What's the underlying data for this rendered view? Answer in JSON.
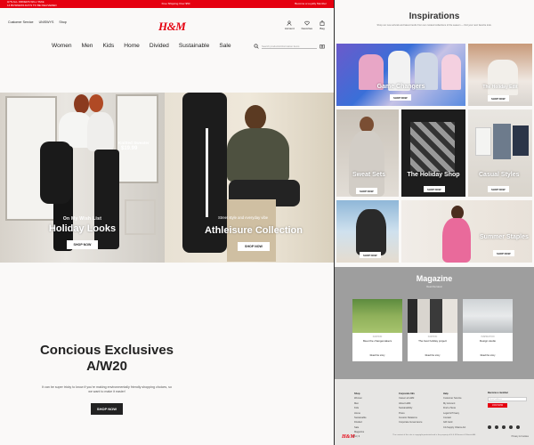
{
  "colors": {
    "brand_red": "#e50010",
    "magazine_bg": "#9e9e9e",
    "footer_bg": "#e7e6e4"
  },
  "topbar": {
    "left_lines": [
      "H7N ALL ORDERS WILL TAKE",
      "14 BUSINESS DAYS TO BE DELIVERED"
    ],
    "center": "Free Shipping Over $50",
    "right": "Become a Loyalty Member"
  },
  "header": {
    "links": [
      "Customer Service",
      "UNISWYS",
      "Shop"
    ],
    "logo": "H&M",
    "icons": [
      {
        "name": "account-icon",
        "label": "Account"
      },
      {
        "name": "favorites-icon",
        "label": "Favorites"
      },
      {
        "name": "bag-icon",
        "label": "Bag"
      }
    ],
    "nav": [
      "Women",
      "Men",
      "Kids",
      "Home",
      "Divided",
      "Sustainable",
      "Sale"
    ],
    "search_placeholder": "Search products/information items"
  },
  "hero": {
    "left": {
      "subtitle": "On My Wish List",
      "title": "Holiday Looks",
      "button": "SHOP NOW",
      "tag_name": "Knitted Sweater",
      "tag_price": "$19.99"
    },
    "right": {
      "subtitle": "Street style and everyday vibe",
      "title": "Athleisure Collection",
      "button": "SHOP NOW"
    }
  },
  "conscious": {
    "title_line1": "Concious Exclusives",
    "title_line2": "A/W20",
    "description": "It can be super tricky to know if you're making environmentally friendly shopping choices, so we want to make it easier!",
    "button": "SHOP NOW"
  },
  "inspirations": {
    "title": "Inspirations",
    "description": "Shop our new arrivals and latest trends from our curated collections of the season — find your next favorite look.",
    "tiles": [
      {
        "label": "Game Changers",
        "button": "SHOP NOW"
      },
      {
        "label": "The Holiday Edit",
        "button": "SHOP NOW"
      },
      {
        "label": "Sweat Sets",
        "button": "SHOP NOW"
      },
      {
        "label": "The Holiday Shop",
        "button": "SHOP NOW"
      },
      {
        "label": "Casual Styles",
        "button": "SHOP NOW"
      },
      {
        "label": "",
        "button": "SHOP NOW"
      },
      {
        "label": "Summer Staples",
        "button": "SHOP NOW"
      }
    ]
  },
  "magazine": {
    "title": "Magazine",
    "subtitle": "Read the latest",
    "cards": [
      {
        "kicker": "FASHION",
        "title": "Meet the changemakers",
        "more": "Read the story"
      },
      {
        "kicker": "FASHION",
        "title": "The best holiday project",
        "more": "Read the story"
      },
      {
        "kicker": "INSPIRATION",
        "title": "Design studio",
        "more": "Read the story"
      }
    ]
  },
  "footer": {
    "columns": [
      {
        "heading": "Shop",
        "items": [
          "Women",
          "Men",
          "Kids",
          "Home",
          "Sustainable",
          "Divided",
          "Sale",
          "Magazine"
        ]
      },
      {
        "heading": "Corporate Info",
        "items": [
          "Career at H&M",
          "About H&M",
          "Sustainability",
          "Press",
          "Investor Relations",
          "Corporate Governance"
        ]
      },
      {
        "heading": "Help",
        "items": [
          "Customer Service",
          "My Account",
          "Find a Store",
          "Legal & Privacy",
          "Contact",
          "Gift Card",
          "CA Supply Chains Act"
        ]
      }
    ],
    "newsletter_heading": "Become a member",
    "newsletter_placeholder": "Email address",
    "join_button": "JOIN NOW",
    "logo": "H&M",
    "locale": "USA | $",
    "copyright": "The content of this site is copyright-protected and is the property of H & M Hennes & Mauritz AB.",
    "right_text": "Privacy & Cookies"
  }
}
